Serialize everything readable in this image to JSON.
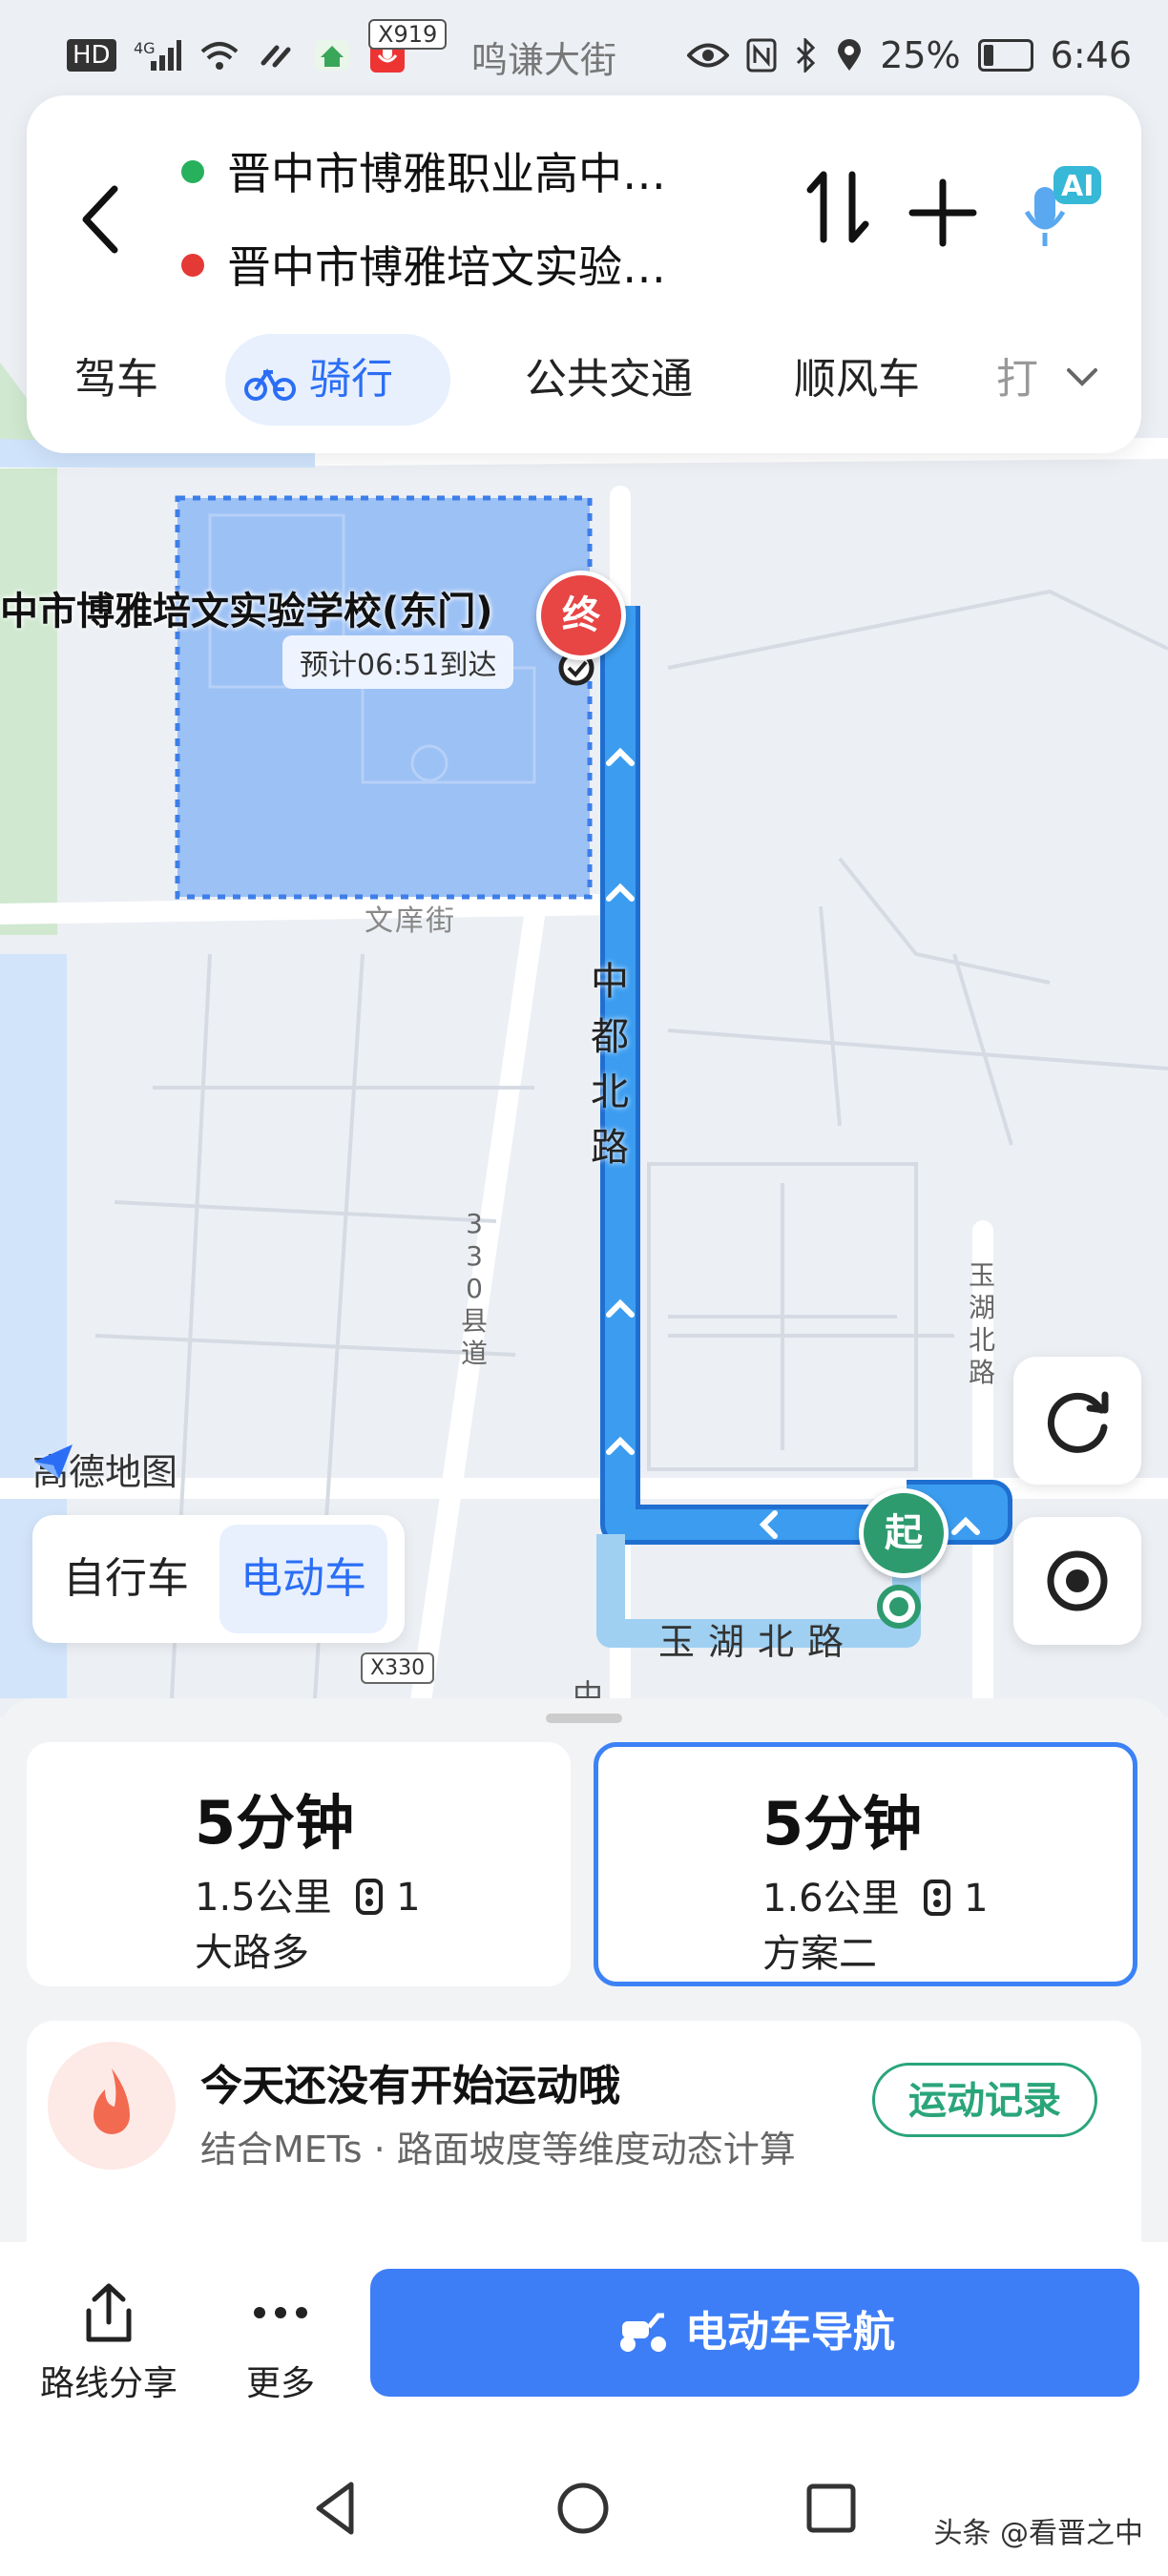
{
  "status_bar": {
    "left_icons": [
      "hd-icon",
      "signal-4g-icon",
      "wifi-icon",
      "link-icon",
      "app-home-icon",
      "recorder-icon"
    ],
    "badge": "X919",
    "street_label": "鸣谦大街",
    "battery": "25%",
    "time": "6:46"
  },
  "route_header": {
    "origin": "晋中市博雅职业高中…",
    "destination": "晋中市博雅培文实验…",
    "ai_badge": "AI",
    "colors": {
      "origin_dot": "#27b15d",
      "destination_dot": "#e53935"
    }
  },
  "mode_tabs": [
    {
      "label": "驾车",
      "active": false
    },
    {
      "label": "骑行",
      "active": true
    },
    {
      "label": "公共交通",
      "active": false
    },
    {
      "label": "顺风车",
      "active": false
    },
    {
      "label": "打",
      "active": false
    }
  ],
  "map": {
    "destination_name": "中市博雅培文实验学校(东门)",
    "eta": "预计06:51到达",
    "end_pin": "终",
    "start_pin": "起",
    "roads": {
      "zhongdu": [
        "中",
        "都",
        "北",
        "路"
      ],
      "county330": [
        "3",
        "3",
        "0",
        "县",
        "道"
      ],
      "yuhu_vertical": [
        "玉",
        "湖",
        "北",
        "路"
      ],
      "yuhu_horizontal": "玉湖北路",
      "wenli": "文庠街",
      "cut_label": "中"
    },
    "shield_x330": "X330",
    "logo": "高德地图",
    "colors": {
      "route": "#3c9df0",
      "route_outline": "#1f6fd1",
      "campus": "#9cc1f5",
      "end_pin": "#e84545",
      "start_pin": "#2e9b6f"
    }
  },
  "vehicle_toggle": [
    {
      "label": "自行车",
      "active": false
    },
    {
      "label": "电动车",
      "active": true
    }
  ],
  "route_options": [
    {
      "time": "5分钟",
      "distance": "1.5公里",
      "lights": "1",
      "tag": "大路多",
      "selected": false
    },
    {
      "time": "5分钟",
      "distance": "1.6公里",
      "lights": "1",
      "tag": "方案二",
      "selected": true
    }
  ],
  "sport_card": {
    "title": "今天还没有开始运动哦",
    "subtitle": "结合METs · 路面坡度等维度动态计算",
    "button": "运动记录"
  },
  "actions": {
    "share": "路线分享",
    "more": "更多",
    "navigate": "电动车导航"
  },
  "watermark": "头条 @看晋之中"
}
